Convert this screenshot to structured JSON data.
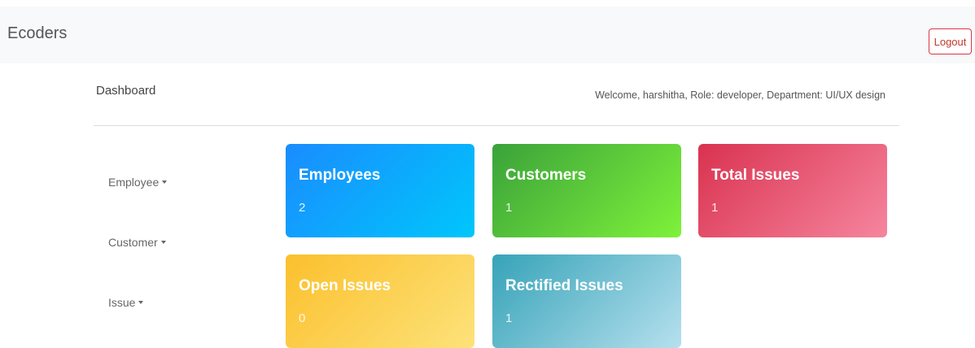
{
  "navbar": {
    "brand": "Ecoders",
    "logout_label": "Logout"
  },
  "header": {
    "title": "Dashboard",
    "welcome": "Welcome, harshitha, Role: developer, Department: UI/UX design"
  },
  "sidebar": {
    "items": [
      {
        "label": "Employee"
      },
      {
        "label": "Customer"
      },
      {
        "label": "Issue"
      }
    ]
  },
  "cards": [
    {
      "title": "Employees",
      "value": "2"
    },
    {
      "title": "Customers",
      "value": "1"
    },
    {
      "title": "Total Issues",
      "value": "1"
    },
    {
      "title": "Open Issues",
      "value": "0"
    },
    {
      "title": "Rectified Issues",
      "value": "1"
    }
  ],
  "colors": {
    "navbar_bg": "#f8f9fa",
    "logout_border": "#dc3545",
    "employees": [
      "#1a8cff",
      "#00c6fb"
    ],
    "customers": [
      "#3aa23a",
      "#7ef23a"
    ],
    "total_issues": [
      "#d9324f",
      "#f6859e"
    ],
    "open_issues": [
      "#fbc02d",
      "#fde27a"
    ],
    "rectified_issues": [
      "#36a3b8",
      "#b6e0ee"
    ]
  }
}
